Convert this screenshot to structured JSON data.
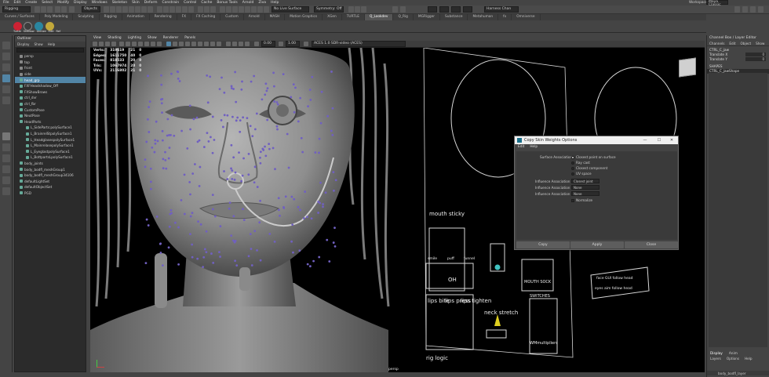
{
  "menubar": [
    "File",
    "Edit",
    "Create",
    "Select",
    "Modify",
    "Display",
    "Windows",
    "Skeleton",
    "Skin",
    "Deform",
    "Constrain",
    "Control",
    "Cache",
    "Bonus Tools",
    "Arnold",
    "Ziva",
    "Help"
  ],
  "status": {
    "mode": "Rigging",
    "objects_label": "Objects",
    "live_surface": "No Live Surface",
    "symmetry": "Symmetry: Off",
    "workspace_label": "Workspace:",
    "workspace_value": "Maya Classic",
    "history_field": "Harness Chan"
  },
  "shelf_tabs": [
    "Curves / Surfaces",
    "Poly Modeling",
    "Sculpting",
    "Rigging",
    "Animation",
    "Rendering",
    "FX",
    "FX Caching",
    "Custom",
    "Arnold",
    "MASH",
    "Motion Graphics",
    "XGen",
    "TURTLE",
    "Q_Lookdev",
    "Q_Rig",
    "MGRigger",
    "Substance",
    "Metahuman",
    "fx",
    "Omniverse"
  ],
  "shelf_active": "Q_Lookdev",
  "shelf_buttons": [
    "Turtle",
    "Shadow",
    "Unitize",
    "Edit",
    "Ref"
  ],
  "outliner": {
    "title": "Outliner",
    "menu": [
      "Display",
      "Show",
      "Help"
    ],
    "items": [
      {
        "label": "persp",
        "sel": false
      },
      {
        "label": "top",
        "sel": false
      },
      {
        "label": "front",
        "sel": false
      },
      {
        "label": "side",
        "sel": false
      },
      {
        "label": "head_grp",
        "sel": true
      },
      {
        "label": "FXFHeadshadow_Off",
        "sel": false
      },
      {
        "label": "FXShowBrows",
        "sel": false
      },
      {
        "label": "ctrl_dvr",
        "sel": false
      },
      {
        "label": "ctrl_fbr",
        "sel": false
      },
      {
        "label": "CustomPose",
        "sel": false
      },
      {
        "label": "NeutPose",
        "sel": false
      },
      {
        "label": "HeadParts",
        "sel": false
      },
      {
        "label": "L_SideParts:polySurface1",
        "sel": false
      },
      {
        "label": "L_BrainrelStpolySurface1",
        "sel": false
      },
      {
        "label": "L_HeadglasespolySurface1",
        "sel": false
      },
      {
        "label": "L_MainrelasepolySurface1",
        "sel": false
      },
      {
        "label": "L_EyeglastpolySurface1",
        "sel": false
      },
      {
        "label": "L_BottpartsLpolySurface1",
        "sel": false
      },
      {
        "label": "body_joints",
        "sel": false
      },
      {
        "label": "body_bodfl_meshGroup1",
        "sel": false
      },
      {
        "label": "body_bodfl_meshGroup34106",
        "sel": false
      },
      {
        "label": "defaultLightSet",
        "sel": false
      },
      {
        "label": "defaultObjectSet",
        "sel": false
      },
      {
        "label": "PGD",
        "sel": false
      }
    ]
  },
  "viewport": {
    "menu": [
      "View",
      "Shading",
      "Lighting",
      "Show",
      "Renderer",
      "Panels"
    ],
    "colorspace": "ACES 1.0 SDR-video (ACES)",
    "camera_value": "0.00",
    "gamma_value": "1.00",
    "hud": [
      {
        "k": "Verts:",
        "a": "319619",
        "b": "21",
        "c": "0"
      },
      {
        "k": "Edges:",
        "a": "1611750",
        "b": "40",
        "c": "0"
      },
      {
        "k": "Faces:",
        "a": "818533",
        "b": "20",
        "c": "0"
      },
      {
        "k": "Tris:",
        "a": "1067974",
        "b": "20",
        "c": "0"
      },
      {
        "k": "UVs:",
        "a": "2116802",
        "b": "21",
        "c": "0"
      }
    ],
    "camera_name": "persp",
    "rig_labels": {
      "mouth_sticky": "mouth sticky",
      "smile": "smile",
      "puff": "puff",
      "funnel": "funnel",
      "oh": "OH",
      "lips_bite": "lips bite",
      "lips_press": "lips press",
      "lips_tighten": "lips tighten",
      "neck_stretch": "neck stretch",
      "switches": "SWITCHES",
      "rig_logic": "rig logic",
      "wm_multipliers": "WMmultipliers",
      "face_gui": "face GUI follow head",
      "eyes_aim": "eyes aim follow head",
      "mouth_sock": "MOUTH SOCK"
    }
  },
  "channelbox": {
    "title": "Channel Box / Layer Editor",
    "menu": [
      "Channels",
      "Edit",
      "Object",
      "Show"
    ],
    "object": "CTRL_C_jaw",
    "attrs": [
      {
        "k": "Translate X",
        "v": "0"
      },
      {
        "k": "Translate Y",
        "v": "0"
      }
    ],
    "shapes_label": "SHAPES",
    "shape_name": "CTRL_C_jawShape",
    "bottom_tabs": [
      "Display",
      "Anim"
    ],
    "bottom_menu": [
      "Layers",
      "Options",
      "Help"
    ],
    "layer_name": "body_bodfl_layer"
  },
  "dialog": {
    "title": "Copy Skin Weights Options",
    "menu": [
      "Edit",
      "Help"
    ],
    "surface_association_label": "Surface Association:",
    "surface_options": [
      {
        "label": "Closest point on surface",
        "on": true
      },
      {
        "label": "Ray cast",
        "on": false
      },
      {
        "label": "Closest component",
        "on": false
      },
      {
        "label": "UV space",
        "on": false
      }
    ],
    "influences": [
      {
        "label": "Influence Association 1:",
        "value": "Closest joint"
      },
      {
        "label": "Influence Association 2:",
        "value": "None"
      },
      {
        "label": "Influence Association 3:",
        "value": "None"
      }
    ],
    "normalize_label": "Normalize",
    "buttons": {
      "copy": "Copy",
      "apply": "Apply",
      "close": "Close"
    },
    "win_buttons": {
      "min": "—",
      "max": "☐",
      "close": "✕"
    }
  }
}
